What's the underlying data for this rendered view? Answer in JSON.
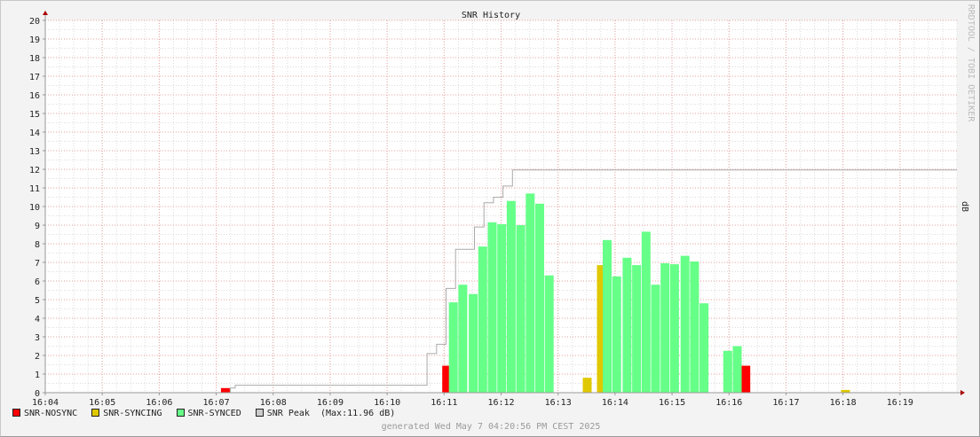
{
  "chart_data": {
    "type": "area",
    "title": "SNR History",
    "ylabel": "dB",
    "watermark": "RRDTOOL / TOBI OETIKER",
    "ylim": [
      0,
      20
    ],
    "yticks": [
      0,
      1,
      2,
      3,
      4,
      5,
      6,
      7,
      8,
      9,
      10,
      11,
      12,
      13,
      14,
      15,
      16,
      17,
      18,
      19,
      20
    ],
    "xlim": [
      "16:04",
      "16:20"
    ],
    "xticks": [
      "16:04",
      "16:05",
      "16:06",
      "16:07",
      "16:08",
      "16:09",
      "16:10",
      "16:11",
      "16:12",
      "16:13",
      "16:14",
      "16:15",
      "16:16",
      "16:17",
      "16:18",
      "16:19"
    ],
    "grid": true,
    "legend_position": "bottom-left",
    "series": [
      {
        "name": "SNR-NOSYNC",
        "color": "#ff0000",
        "points": [
          [
            "16:07:05",
            0.25
          ],
          [
            "16:10:58",
            1.45
          ],
          [
            "16:16:13",
            1.45
          ]
        ]
      },
      {
        "name": "SNR-SYNCING",
        "color": "#e0c800",
        "points": [
          [
            "16:13:26",
            0.8
          ],
          [
            "16:13:41",
            6.85
          ],
          [
            "16:17:58",
            0.15
          ]
        ]
      },
      {
        "name": "SNR-SYNCED",
        "color": "#66ff88",
        "points": [
          [
            "16:11:05",
            4.85
          ],
          [
            "16:11:15",
            5.8
          ],
          [
            "16:11:26",
            5.3
          ],
          [
            "16:11:36",
            7.85
          ],
          [
            "16:11:46",
            9.15
          ],
          [
            "16:11:56",
            9.05
          ],
          [
            "16:12:06",
            10.3
          ],
          [
            "16:12:16",
            9.0
          ],
          [
            "16:12:26",
            10.7
          ],
          [
            "16:12:36",
            10.15
          ],
          [
            "16:12:46",
            6.3
          ],
          [
            "16:13:47",
            8.2
          ],
          [
            "16:13:57",
            6.25
          ],
          [
            "16:14:08",
            7.25
          ],
          [
            "16:14:18",
            6.85
          ],
          [
            "16:14:28",
            8.65
          ],
          [
            "16:14:38",
            5.8
          ],
          [
            "16:14:48",
            6.95
          ],
          [
            "16:14:58",
            6.9
          ],
          [
            "16:15:09",
            7.35
          ],
          [
            "16:15:19",
            7.05
          ],
          [
            "16:15:29",
            4.8
          ],
          [
            "16:15:54",
            2.25
          ],
          [
            "16:16:04",
            2.5
          ]
        ]
      },
      {
        "name": "SNR Peak",
        "color": "#aaaaaa",
        "note": "(Max:11.96 dB)",
        "steps": [
          [
            "16:04:00",
            0
          ],
          [
            "16:07:15",
            0.25
          ],
          [
            "16:07:20",
            0.4
          ],
          [
            "16:10:42",
            2.1
          ],
          [
            "16:10:52",
            2.6
          ],
          [
            "16:11:02",
            5.6
          ],
          [
            "16:11:12",
            7.7
          ],
          [
            "16:11:32",
            8.9
          ],
          [
            "16:11:42",
            10.2
          ],
          [
            "16:11:52",
            10.5
          ],
          [
            "16:12:02",
            11.1
          ],
          [
            "16:12:12",
            11.96
          ],
          [
            "16:20:00",
            11.96
          ]
        ]
      }
    ]
  },
  "footer": "generated Wed May  7 04:20:56 PM CEST 2025"
}
